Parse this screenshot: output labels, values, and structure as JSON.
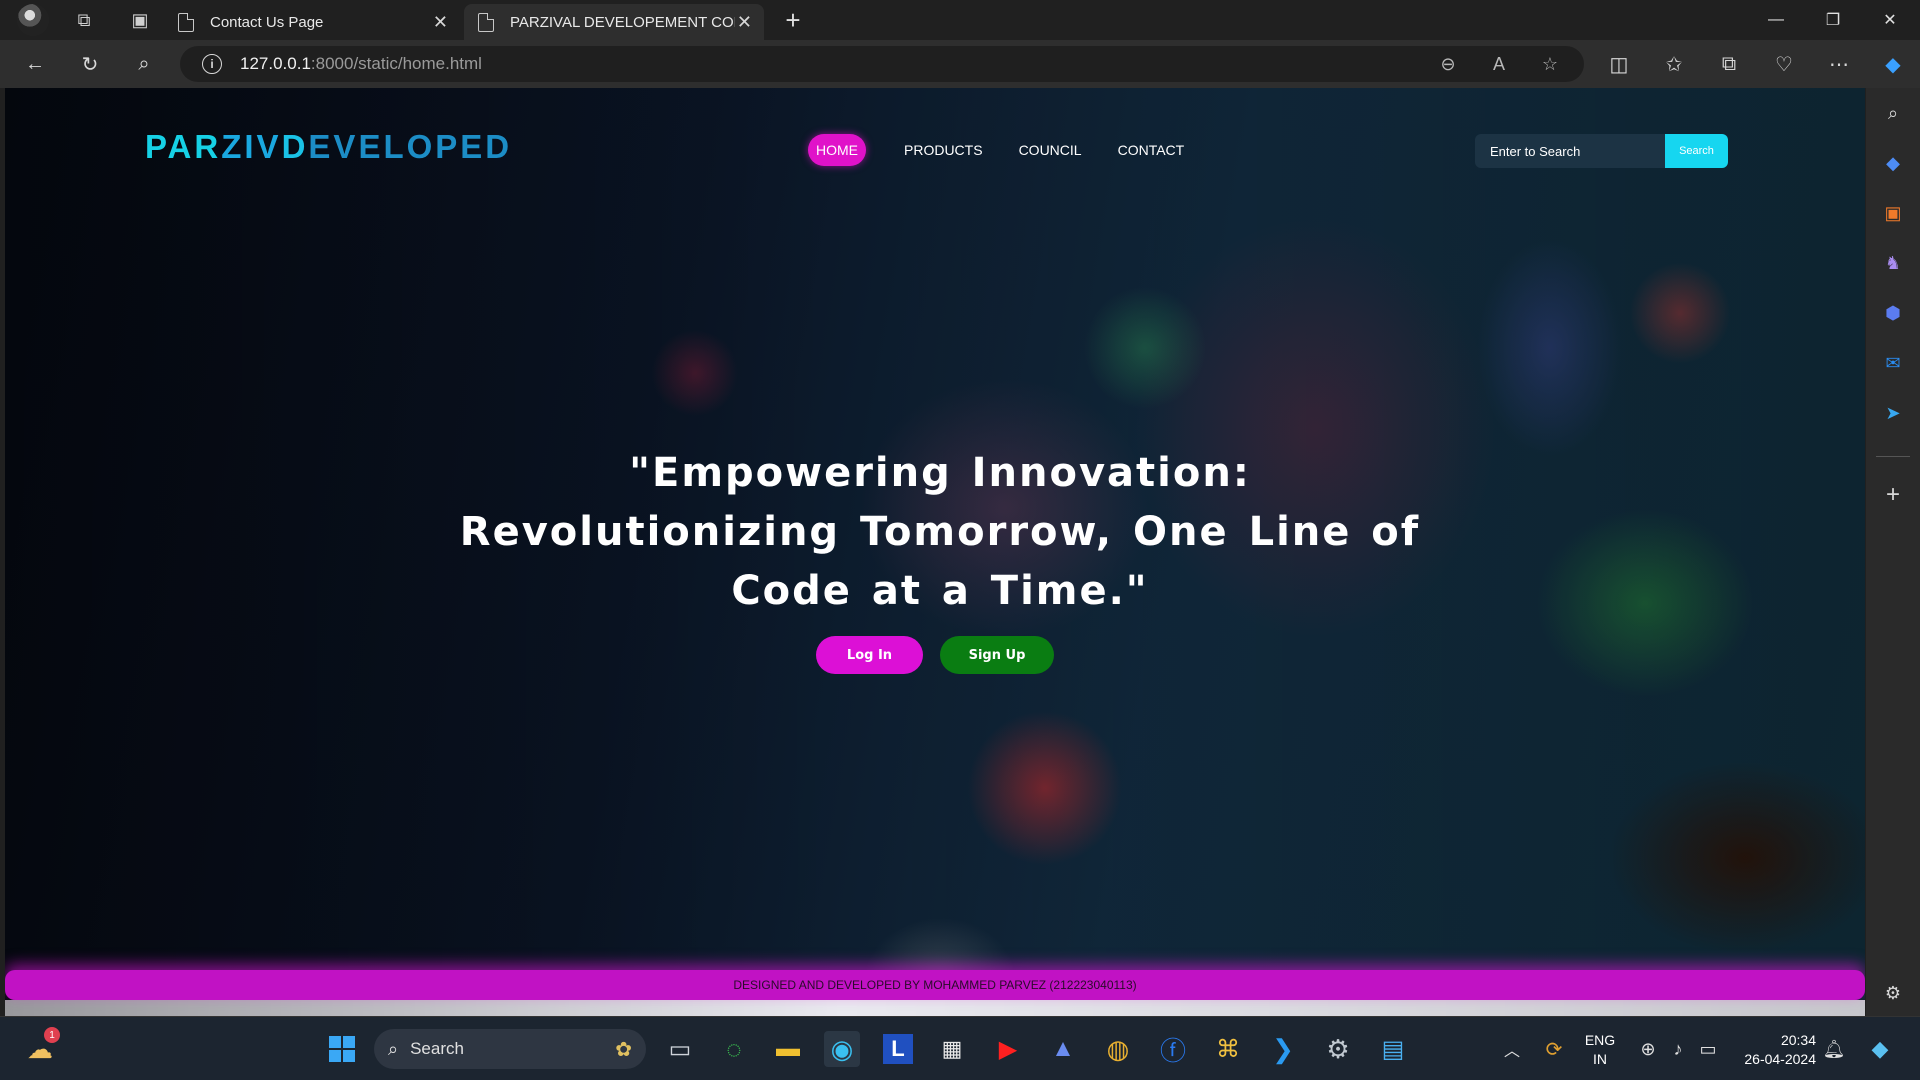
{
  "browser": {
    "tabs": [
      {
        "title": "Contact Us Page",
        "active": false
      },
      {
        "title": "PARZIVAL DEVELOPEMENT COMPANY",
        "active": true
      }
    ],
    "url_host": "127.0.0.1",
    "url_rest": ":8000/static/home.html"
  },
  "page": {
    "brand": {
      "part1": "PAR",
      "part2": "ZIV",
      "part3": "D",
      "part4": "EVELOPED"
    },
    "nav": [
      "HOME",
      "PRODUCTS",
      "COUNCIL",
      "CONTACT"
    ],
    "search": {
      "placeholder": "Enter to Search",
      "button": "Search"
    },
    "hero_quote": "\"Empowering Innovation: Revolutionizing Tomorrow, One Line of Code at a Time.\"",
    "buttons": {
      "login": "Log In",
      "signup": "Sign Up"
    },
    "footer": "DESIGNED AND DEVELOPED BY MOHAMMED PARVEZ (212223040113)",
    "colors": {
      "accent_magenta": "#e012c9",
      "accent_cyan": "#16d6f0",
      "signup_green": "#0a7d12"
    }
  },
  "taskbar": {
    "search_label": "Search",
    "weather_badge": "1",
    "lang_line1": "ENG",
    "lang_line2": "IN",
    "time": "20:34",
    "date": "26-04-2024"
  }
}
